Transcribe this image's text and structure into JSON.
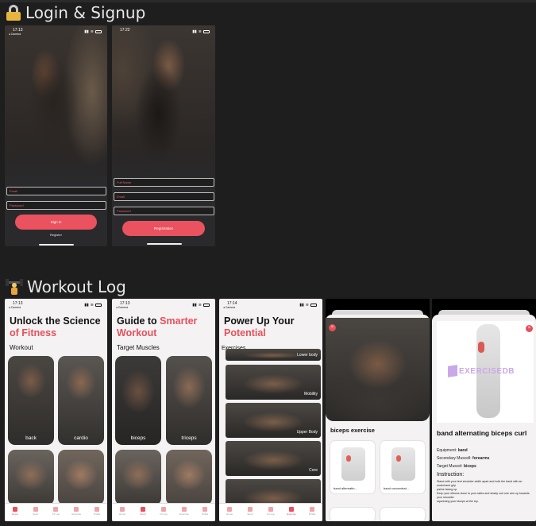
{
  "sections": {
    "login": {
      "title": "Login & Signup",
      "icon": "lock-icon"
    },
    "workout": {
      "title": "Workout Log",
      "icon": "weight-lifter-icon"
    }
  },
  "login_screen": {
    "time": "17:13",
    "camera": "◂ Camera",
    "email_placeholder": "Email",
    "password_placeholder": "Password",
    "sign_in": "Sign in",
    "register_link": "Register"
  },
  "signup_screen": {
    "time": "17:22",
    "fullname_placeholder": "Full Name",
    "email_placeholder": "Email",
    "password_placeholder": "Password",
    "register": "Registration"
  },
  "workout_home": {
    "time": "17:13",
    "camera": "◂ Camera",
    "title_line1": "Unlock the Science",
    "title_accent": "of Fitness",
    "subtitle": "Workout",
    "cards": [
      "back",
      "cardio"
    ]
  },
  "guide_screen": {
    "time": "17:13",
    "camera": "◂ Camera",
    "title_line1": "Guide to ",
    "title_accent1": "Smarter",
    "title_accent2": "Workout",
    "subtitle": "Target Muscles",
    "cards": [
      "biceps",
      "triceps"
    ]
  },
  "exercises_screen": {
    "time": "17:14",
    "camera": "◂ Camera",
    "title_line1": "Power Up Your",
    "title_accent": "Potential",
    "subtitle": "Exercises",
    "top_label": "Lower body",
    "rows": [
      "Mobility",
      "Upper Body",
      "Core"
    ]
  },
  "exercise_detail": {
    "section_title": "biceps exercise",
    "cards": [
      "band alternatin...",
      "band concentrat..."
    ]
  },
  "exercise_info": {
    "watermark": "EXERCISEDB",
    "name": "band alternating biceps curl",
    "equipment_label": "Equipment:",
    "equipment_value": "band",
    "secondary_label": "Secondary Muscell:",
    "secondary_value": "forearms",
    "target_label": "Target Muscel:",
    "target_value": "biceps",
    "instruction_heading": "Instruction:",
    "instruction_lines": [
      "Stand with your feet shoulder-width apart and hold the band with an underhand grip",
      "palms facing up.",
      "Keep your elbows close to your sides and slowly curl one arm up towards your shoulder",
      "squeezing your biceps at the top."
    ]
  },
  "tabbar": [
    "Home",
    "Sport",
    "Fit Log",
    "Exercise",
    "Profile"
  ]
}
